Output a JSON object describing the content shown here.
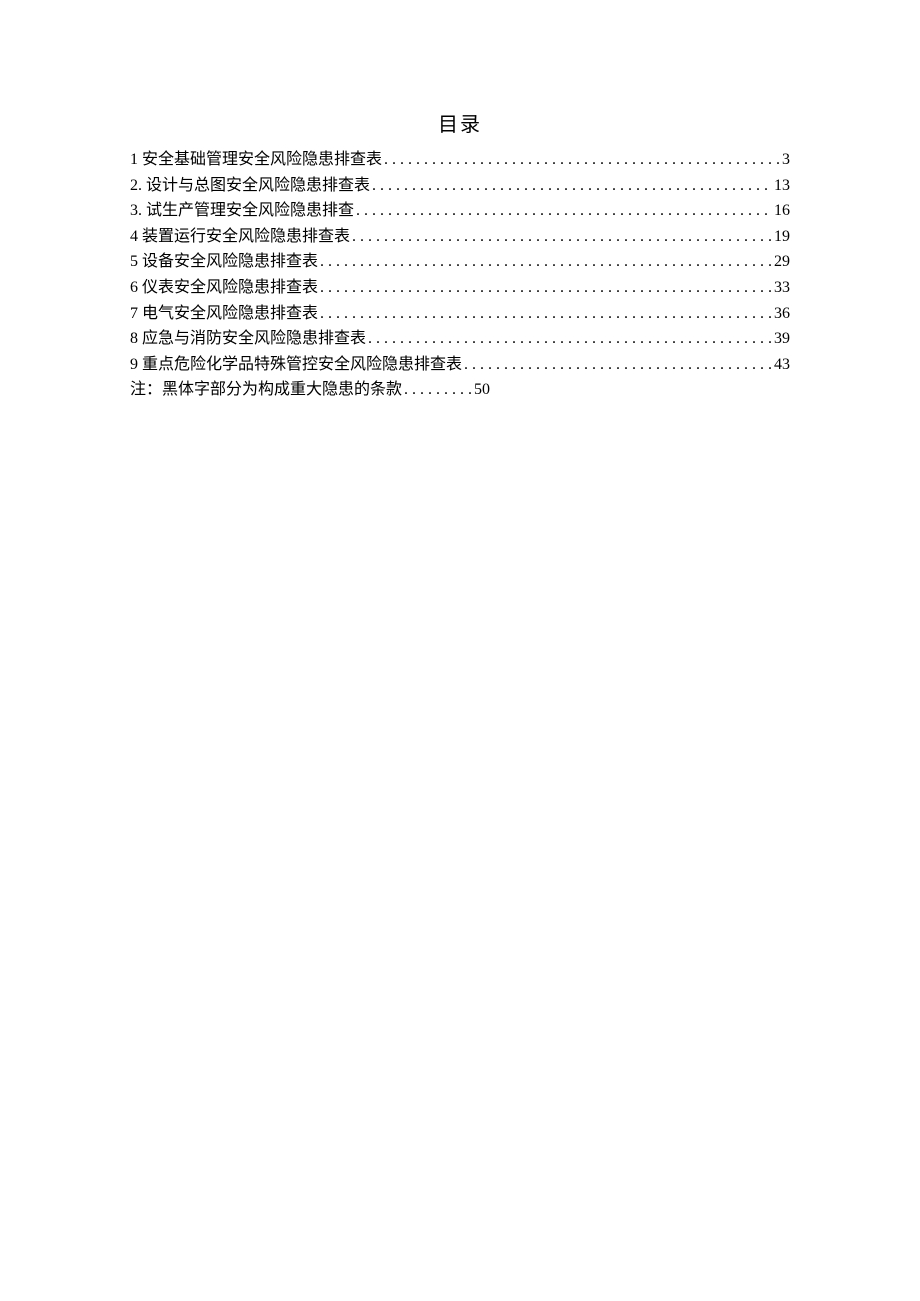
{
  "title": "目录",
  "entries": [
    {
      "label": "1 安全基础管理安全风险隐患排查表",
      "page": "3"
    },
    {
      "label": "2. 设计与总图安全风险隐患排查表",
      "page": "13"
    },
    {
      "label": "3. 试生产管理安全风险隐患排查",
      "page": "16"
    },
    {
      "label": "4 装置运行安全风险隐患排查表",
      "page": "19"
    },
    {
      "label": "5 设备安全风险隐患排查表",
      "page": "29"
    },
    {
      "label": "6 仪表安全风险隐患排查表",
      "page": "33"
    },
    {
      "label": "7 电气安全风险隐患排查表",
      "page": "36"
    },
    {
      "label": "8 应急与消防安全风险隐患排查表",
      "page": "39"
    },
    {
      "label": "9 重点危险化学品特殊管控安全风险隐患排查表",
      "page": "43"
    }
  ],
  "note": {
    "label": "注：黑体字部分为构成重大隐患的条款",
    "dots": ". . . . . . . . .",
    "page": "50"
  }
}
